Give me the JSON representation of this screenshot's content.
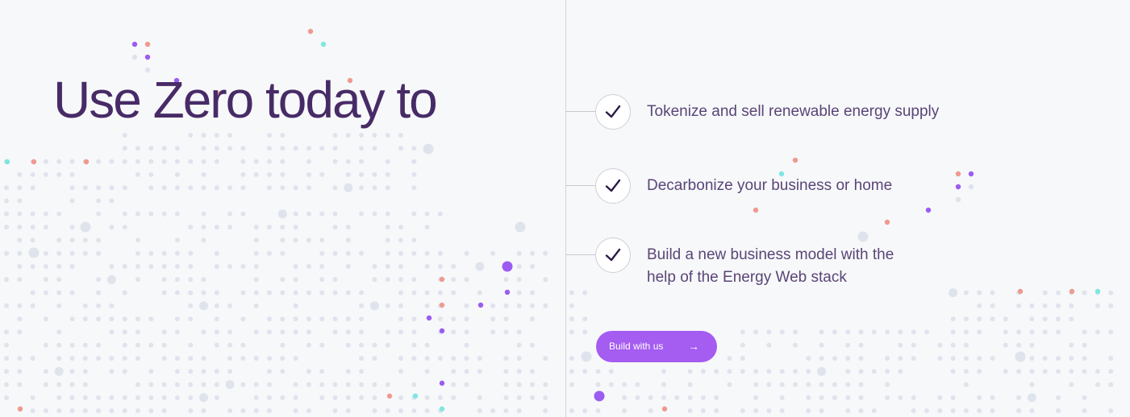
{
  "headline": "Use Zero today to",
  "features": [
    {
      "text": "Tokenize and sell renewable energy supply",
      "icon": "check-icon"
    },
    {
      "text": "Decarbonize your business or home",
      "icon": "check-icon"
    },
    {
      "text": "Build a new business model with the help of the Energy Web stack",
      "icon": "check-icon"
    }
  ],
  "cta": {
    "label": "Build with us",
    "icon": "arrow-right-icon"
  },
  "background": {
    "pattern": "dotted-world-map"
  },
  "colors": {
    "headline": "#472b66",
    "feature_text": "#5a4577",
    "accent": "#a55cf0",
    "dot_grey": "#dfe3ec",
    "dot_purple": "#9b5cf2",
    "dot_salmon": "#ef9a8f",
    "dot_cyan": "#7fe6e0",
    "background": "#f7f8fa"
  }
}
